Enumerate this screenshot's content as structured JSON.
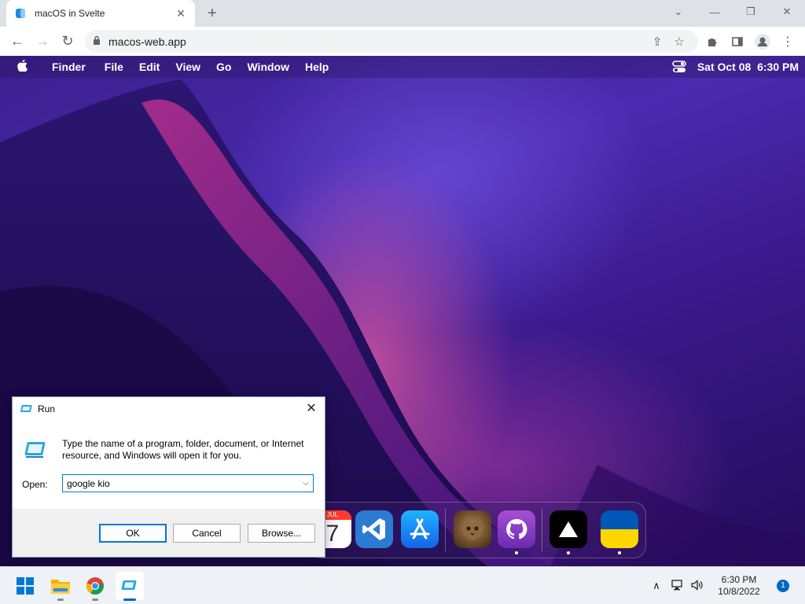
{
  "browser": {
    "tab_title": "macOS in Svelte",
    "new_tab": "+",
    "url": "macos-web.app"
  },
  "menubar": {
    "items": [
      "Finder",
      "File",
      "Edit",
      "View",
      "Go",
      "Window",
      "Help"
    ],
    "datetime": "Sat Oct 08  6:30 PM"
  },
  "dock": {
    "calendar_month": "JUL",
    "calendar_day": "7"
  },
  "run_dialog": {
    "title": "Run",
    "description": "Type the name of a program, folder, document, or Internet resource, and Windows will open it for you.",
    "open_label": "Open:",
    "input_value": "google kio",
    "ok_label": "OK",
    "cancel_label": "Cancel",
    "browse_label": "Browse..."
  },
  "taskbar": {
    "time": "6:30 PM",
    "date": "10/8/2022",
    "notification_count": "1"
  },
  "colors": {
    "accent": "#0078d4",
    "wallpaper_base": "#3a1f8f"
  }
}
